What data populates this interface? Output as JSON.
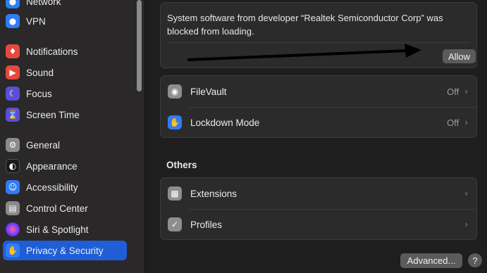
{
  "sidebar": {
    "items": [
      {
        "label": "Network",
        "icon": "globe-icon",
        "color": "#2f7cf6"
      },
      {
        "label": "VPN",
        "icon": "globe-icon",
        "color": "#2f7cf6"
      },
      {
        "label": "Notifications",
        "icon": "bell-icon",
        "color": "#e5483e"
      },
      {
        "label": "Sound",
        "icon": "speaker-icon",
        "color": "#e5483e"
      },
      {
        "label": "Focus",
        "icon": "moon-icon",
        "color": "#5a4fd6"
      },
      {
        "label": "Screen Time",
        "icon": "hourglass-icon",
        "color": "#5a4fd6"
      },
      {
        "label": "General",
        "icon": "gear-icon",
        "color": "#8a8a8a"
      },
      {
        "label": "Appearance",
        "icon": "appearance-icon",
        "color": "#1a1a1a"
      },
      {
        "label": "Accessibility",
        "icon": "accessibility-icon",
        "color": "#2f7cf6"
      },
      {
        "label": "Control Center",
        "icon": "control-center-icon",
        "color": "#8a8a8a"
      },
      {
        "label": "Siri & Spotlight",
        "icon": "siri-icon",
        "color": "#b04fd6"
      },
      {
        "label": "Privacy & Security",
        "icon": "hand-icon",
        "color": "#2f7cf6"
      }
    ]
  },
  "alert": {
    "message": "System software from developer “Realtek Semiconductor Corp” was blocked from loading.",
    "allow_label": "Allow"
  },
  "security": {
    "rows": [
      {
        "label": "FileVault",
        "value": "Off",
        "icon": "lock-icon",
        "color": "#8e8e8e"
      },
      {
        "label": "Lockdown Mode",
        "value": "Off",
        "icon": "hand-icon",
        "color": "#2f7cf6"
      }
    ]
  },
  "others": {
    "title": "Others",
    "rows": [
      {
        "label": "Extensions",
        "icon": "puzzle-icon",
        "color": "#8e8e8e"
      },
      {
        "label": "Profiles",
        "icon": "badge-check-icon",
        "color": "#8e8e8e"
      }
    ]
  },
  "footer": {
    "advanced_label": "Advanced...",
    "help_label": "?"
  }
}
